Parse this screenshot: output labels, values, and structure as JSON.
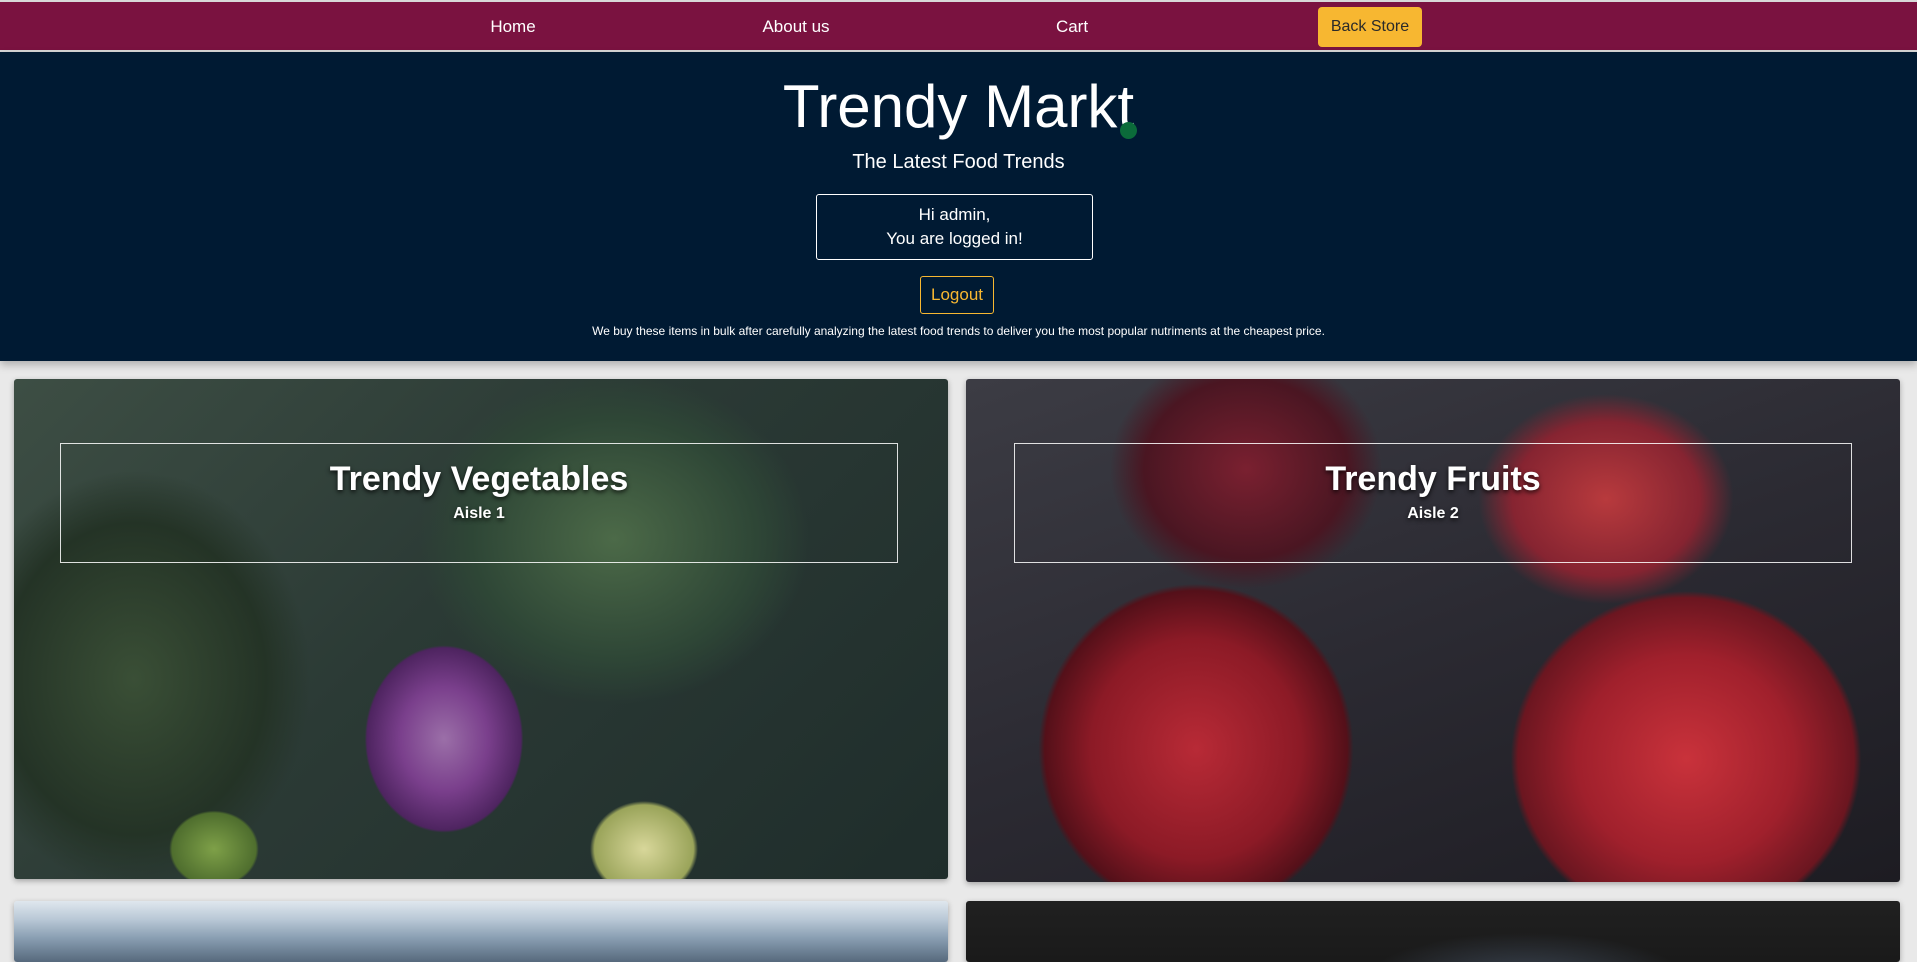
{
  "nav": {
    "home_label": "Home",
    "about_label": "About us",
    "cart_label": "Cart",
    "back_store_label": "Back Store"
  },
  "header": {
    "title": "Trendy Markt",
    "subtitle": "The Latest Food Trends",
    "greeting_line1": "Hi admin,",
    "greeting_line2": "You are logged in!",
    "logout_label": "Logout",
    "tagline": "We buy these items in bulk after carefully analyzing the latest food trends to deliver you the most popular nutriments at the cheapest price."
  },
  "categories": [
    {
      "title": "Trendy Vegetables",
      "aisle": "Aisle 1",
      "image": "vegetables-photo"
    },
    {
      "title": "Trendy Fruits",
      "aisle": "Aisle 2",
      "image": "apples-photo"
    },
    {
      "title": "",
      "aisle": "",
      "image": "mountains-photo"
    },
    {
      "title": "",
      "aisle": "",
      "image": "dark-photo"
    }
  ],
  "colors": {
    "nav_bg": "#7a1240",
    "header_bg": "#001a33",
    "accent": "#f7b731",
    "status_dot": "#0b6b3a",
    "page_bg": "#e9e9e9"
  }
}
